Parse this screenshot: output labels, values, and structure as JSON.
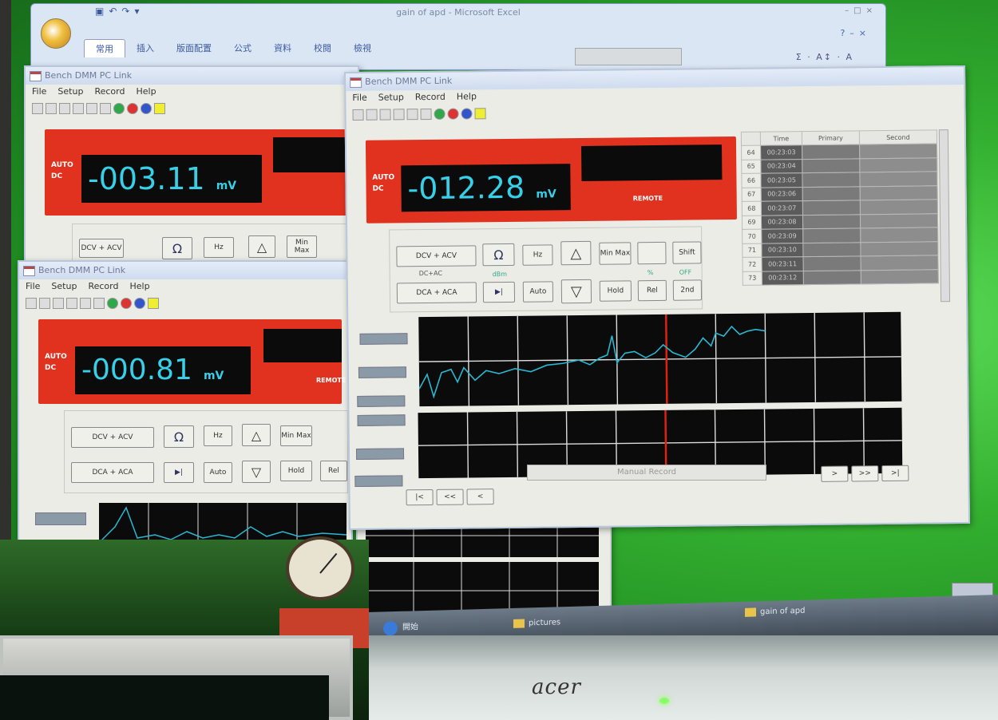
{
  "excel": {
    "title": "gain of apd - Microsoft Excel",
    "tabs": [
      "常用",
      "插入",
      "版面配置",
      "公式",
      "資料",
      "校閱",
      "檢視"
    ]
  },
  "windows": [
    {
      "title": "Bench DMM PC Link",
      "menu": [
        "File",
        "Setup",
        "Record",
        "Help"
      ],
      "mode": "AUTO",
      "coupling": "DC",
      "reading": "-003.11",
      "unit": "mV"
    },
    {
      "title": "Bench DMM PC Link",
      "menu": [
        "File",
        "Setup",
        "Record",
        "Help"
      ],
      "mode": "AUTO",
      "coupling": "DC",
      "reading": "-000.81",
      "unit": "mV",
      "remote": "REMOTE"
    },
    {
      "title": "Bench DMM PC Link",
      "menu": [
        "File",
        "Setup",
        "Record",
        "Help"
      ],
      "mode": "AUTO",
      "coupling": "DC",
      "reading": "-012.28",
      "unit": "mV",
      "remote": "REMOTE",
      "buttons": {
        "dcv": "DCV",
        "acv": "ACV",
        "dca": "DCA",
        "aca": "ACA",
        "dcac": "DC+AC",
        "ohm": "Ω",
        "hz": "Hz",
        "auto": "Auto",
        "hold": "Hold",
        "rel": "Rel",
        "shift": "Shift",
        "second": "2nd",
        "minmax": "Min Max",
        "dbm": "dBm",
        "pct": "%",
        "off": "OFF"
      },
      "table": {
        "headers": [
          "",
          "Time",
          "Primary",
          "Second"
        ],
        "rows": [
          [
            "64",
            "00:23:03"
          ],
          [
            "65",
            "00:23:04"
          ],
          [
            "66",
            "00:23:05"
          ],
          [
            "67",
            "00:23:06"
          ],
          [
            "68",
            "00:23:07"
          ],
          [
            "69",
            "00:23:08"
          ],
          [
            "70",
            "00:23:09"
          ],
          [
            "71",
            "00:23:10"
          ],
          [
            "72",
            "00:23:11"
          ],
          [
            "73",
            "00:23:12"
          ]
        ]
      },
      "manual_record": "Manual Record"
    }
  ],
  "taskbar": {
    "start": "開始",
    "items": [
      "pictures",
      "gain of apd"
    ]
  },
  "monitor": {
    "brand": "acer"
  },
  "colors": {
    "display_red": "#e0321e",
    "lcd_cyan": "#36d0e8",
    "trace": "#2ab8d0",
    "cursor": "#e02010"
  }
}
